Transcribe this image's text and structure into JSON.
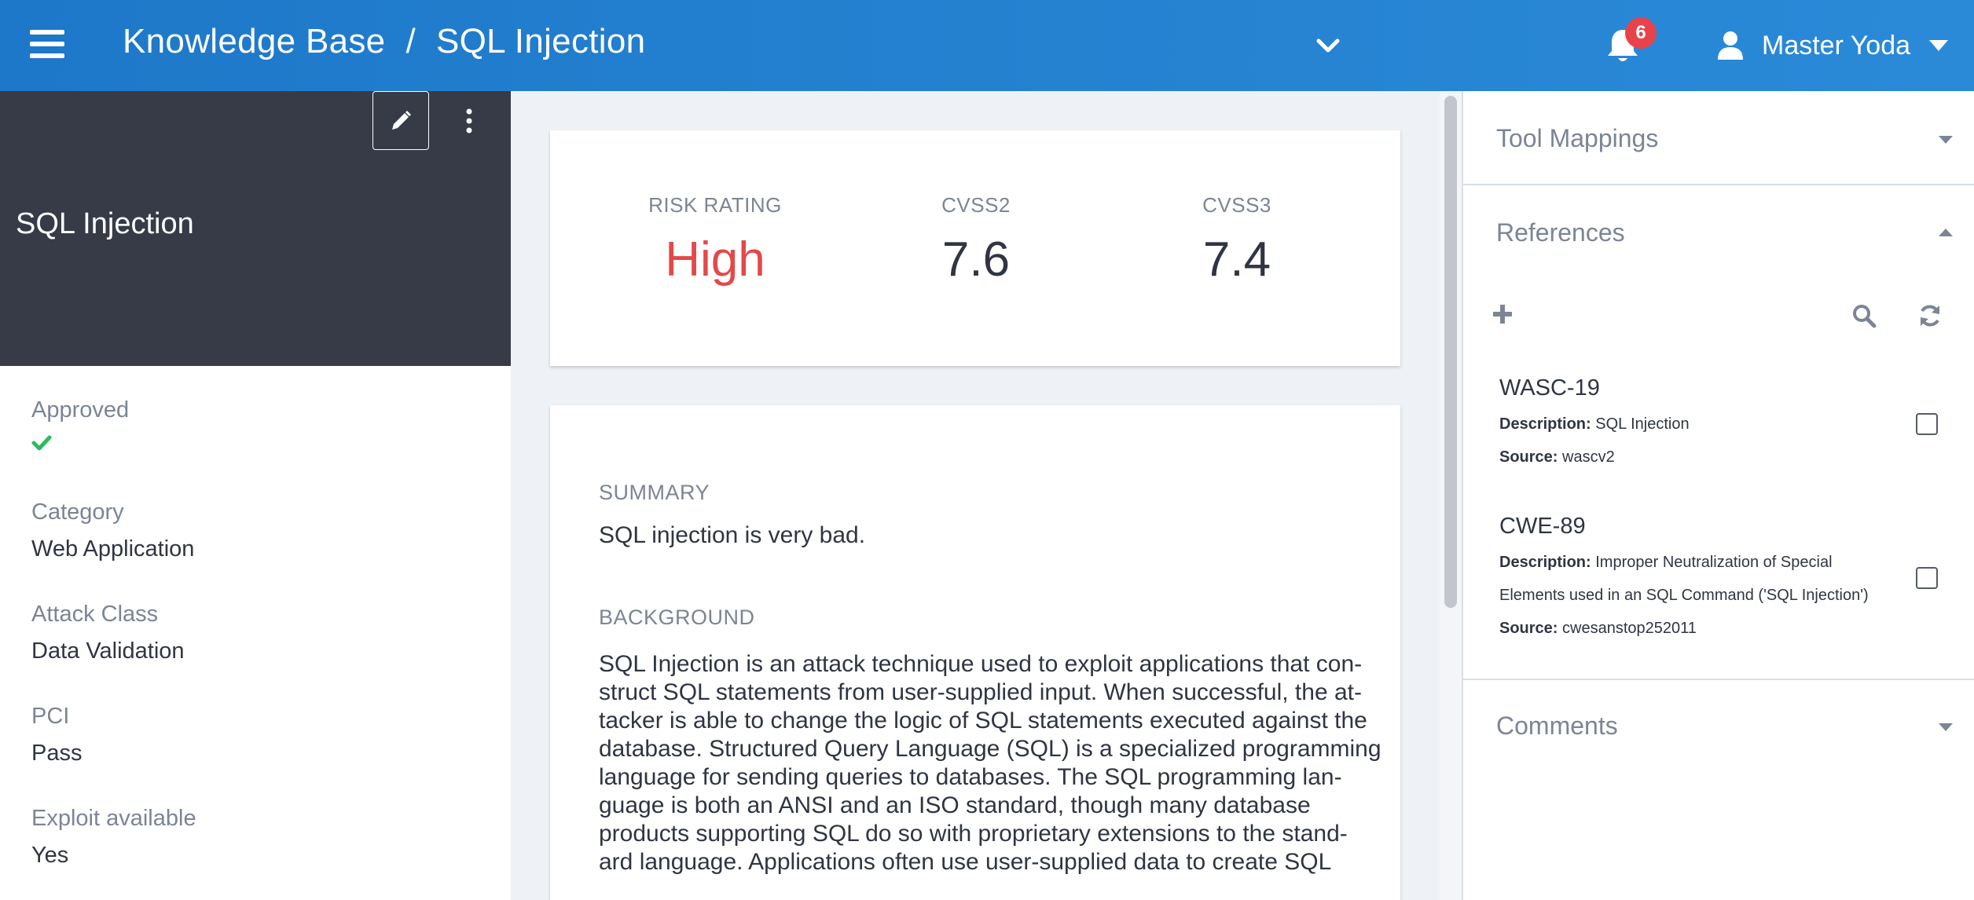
{
  "header": {
    "breadcrumb_root": "Knowledge Base",
    "breadcrumb_separator": "/",
    "breadcrumb_current": "SQL Injection",
    "notification_count": "6",
    "user_name": "Master Yoda"
  },
  "left": {
    "title": "SQL Injection",
    "attributes": [
      {
        "label": "Approved",
        "value": ""
      },
      {
        "label": "Category",
        "value": "Web Application"
      },
      {
        "label": "Attack Class",
        "value": "Data Validation"
      },
      {
        "label": "PCI",
        "value": "Pass"
      },
      {
        "label": "Exploit available",
        "value": "Yes"
      }
    ],
    "approved_icon": "check-icon"
  },
  "ratings": {
    "risk_label": "RISK RATING",
    "risk_value": "High",
    "cvss2_label": "CVSS2",
    "cvss2_value": "7.6",
    "cvss3_label": "CVSS3",
    "cvss3_value": "7.4",
    "risk_color": "#e44848"
  },
  "content": {
    "summary_label": "SUMMARY",
    "summary_text": "SQL injection is very bad.",
    "background_label": "BACKGROUND",
    "background_lines": [
      "SQL Injection is an attack technique used to exploit applications that con-",
      "struct SQL statements from user-supplied input. When successful, the at-",
      "tacker is able to change the logic of SQL statements executed against the",
      "database. Structured Query Language (SQL) is a specialized programming",
      "language for sending queries to databases. The SQL programming lan-",
      "guage is both an ANSI and an ISO standard, though many database",
      "products supporting SQL do so with proprietary extensions to the stand-",
      "ard language. Applications often use user-supplied data to create SQL"
    ]
  },
  "right": {
    "tool_mappings": "Tool Mappings",
    "references": "References",
    "comments": "Comments",
    "desc_label": "Description:",
    "source_label": "Source:",
    "reference_items": [
      {
        "id": "WASC-19",
        "description_lines": [
          "SQL Injection"
        ],
        "source": "wascv2"
      },
      {
        "id": "CWE-89",
        "description_lines": [
          "Improper Neutralization of Special",
          "Elements used in an SQL Command ('SQL Injection')"
        ],
        "source": "cwesanstop252011"
      }
    ]
  },
  "colors": {
    "topbar": "#1e78c9",
    "sidebar_dark": "#363b47",
    "approved_green": "#2dbb5d",
    "badge_red": "#e8434b"
  }
}
